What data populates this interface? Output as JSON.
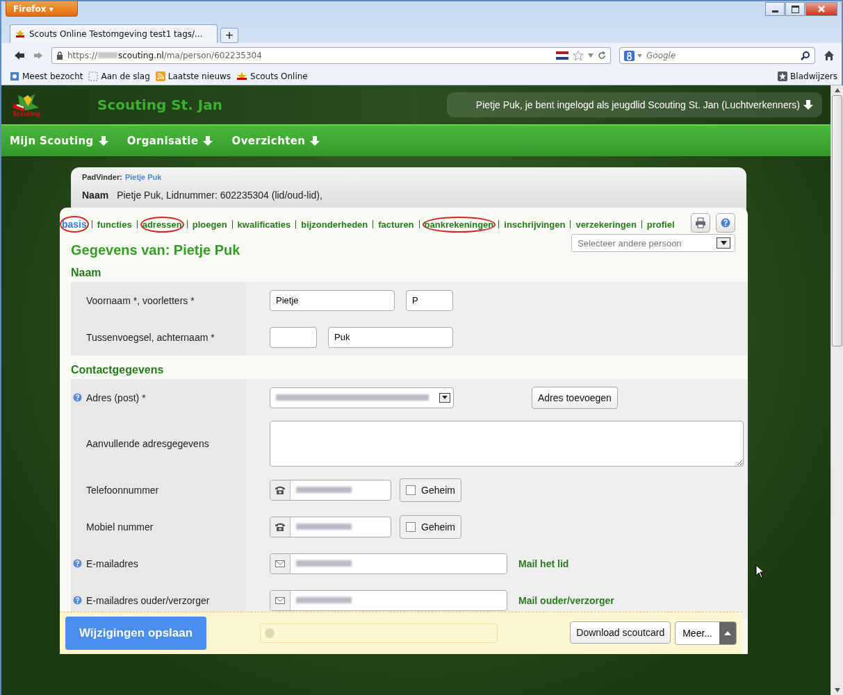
{
  "browser": {
    "menu_button": "Firefox ▾",
    "tab_title": "Scouts Online Testomgeving test1 tags/...",
    "new_tab": "+",
    "url": {
      "scheme": "https://",
      "domain": "scouting.nl",
      "path": "/ma/person/602235304"
    },
    "search_placeholder": "Google",
    "bookmarks": [
      {
        "label": "Meest bezocht",
        "kind": "page"
      },
      {
        "label": "Aan de slag",
        "kind": "blank"
      },
      {
        "label": "Laatste nieuws",
        "kind": "rss"
      },
      {
        "label": "Scouts Online",
        "kind": "scout"
      }
    ],
    "bookmarks_menu": "Bladwijzers"
  },
  "site": {
    "logo_text": "Scouting",
    "title": "Scouting St. Jan",
    "user_notice": "Pietje Puk, je bent ingelogd als jeugdlid Scouting St. Jan (Luchtverkenners)",
    "nav": [
      "Mijn Scouting",
      "Organisatie",
      "Overzichten"
    ]
  },
  "breadcrumb": {
    "label": "PadVinder:",
    "link": "Pietje Puk"
  },
  "summary": {
    "label": "Naam",
    "value": "Pietje Puk, Lidnummer: 602235304 (lid/oud-lid),"
  },
  "tabs": [
    {
      "label": "basis",
      "selected": true,
      "circled": true
    },
    {
      "label": "functies",
      "selected": false,
      "circled": false
    },
    {
      "label": "adressen",
      "selected": false,
      "circled": true
    },
    {
      "label": "ploegen",
      "selected": false,
      "circled": false
    },
    {
      "label": "kwalificaties",
      "selected": false,
      "circled": false
    },
    {
      "label": "bijzonderheden",
      "selected": false,
      "circled": false
    },
    {
      "label": "facturen",
      "selected": false,
      "circled": false
    },
    {
      "label": "bankrekeningen",
      "selected": false,
      "circled": true
    },
    {
      "label": "inschrijvingen",
      "selected": false,
      "circled": false
    },
    {
      "label": "verzekeringen",
      "selected": false,
      "circled": false
    },
    {
      "label": "profiel",
      "selected": false,
      "circled": false
    }
  ],
  "person_select": {
    "placeholder": "Selecteer andere persoon"
  },
  "heading": "Gegevens van: Pietje Puk",
  "sections": [
    {
      "title": "Naam",
      "rows": [
        {
          "kind": "pair",
          "label": "Voornaam *, voorletters *",
          "help": false,
          "first": "Pietje",
          "second": "P"
        },
        {
          "kind": "pair-rev",
          "label": "Tussenvoegsel, achternaam *",
          "help": false,
          "first": "",
          "second": "Puk"
        }
      ]
    },
    {
      "title": "Contactgegevens",
      "rows": [
        {
          "kind": "select",
          "label": "Adres (post) *",
          "help": true,
          "action": "Adres toevoegen"
        },
        {
          "kind": "textarea",
          "label": "Aanvullende adresgegevens",
          "help": false
        },
        {
          "kind": "phone",
          "label": "Telefoonnummer",
          "help": false,
          "secret_label": "Geheim",
          "secret": false
        },
        {
          "kind": "phone",
          "label": "Mobiel nummer",
          "help": false,
          "secret_label": "Geheim",
          "secret": false
        },
        {
          "kind": "email",
          "label": "E-mailadres",
          "help": true,
          "link": "Mail het lid"
        },
        {
          "kind": "email",
          "label": "E-mailadres ouder/verzorger",
          "help": true,
          "link": "Mail ouder/verzorger"
        }
      ]
    }
  ],
  "footer": {
    "save": "Wijzigingen opslaan",
    "download": "Download scoutcard",
    "more": "Meer..."
  }
}
